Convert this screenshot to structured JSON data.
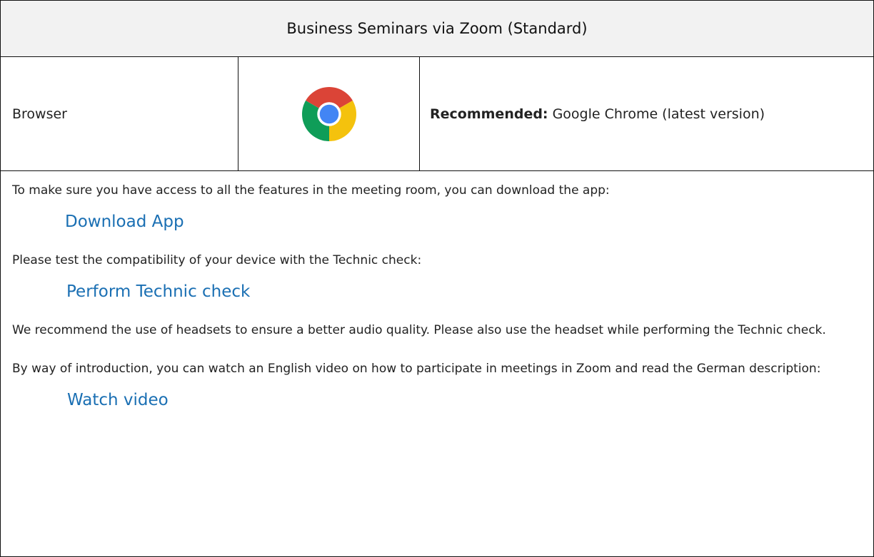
{
  "header": {
    "title": "Business Seminars via Zoom (Standard)"
  },
  "browser_row": {
    "label": "Browser",
    "icon": "chrome-icon",
    "recommended_label": "Recommended:",
    "recommended_value": " Google Chrome (latest version)"
  },
  "content": {
    "intro_app": "To make sure you have access to all the features in the meeting room, you can download the app:",
    "download_app_link": "Download App",
    "intro_check": "Please test the compatibility of your device with the Technic check:",
    "technic_check_link": "Perform Technic check",
    "headset_note": "We recommend the use of headsets to ensure a better audio quality. Please also use the headset while performing the Technic check.",
    "video_intro": "By way of introduction, you can watch an English video on how to participate in meetings in Zoom and read the German description:",
    "watch_video_link": "Watch video"
  },
  "colors": {
    "link": "#1a6fb3",
    "header_bg": "#f2f2f2",
    "border": "#111111",
    "chrome_red": "#db4437",
    "chrome_yellow": "#f4c20d",
    "chrome_green": "#0f9d58",
    "chrome_blue": "#4285f4"
  }
}
